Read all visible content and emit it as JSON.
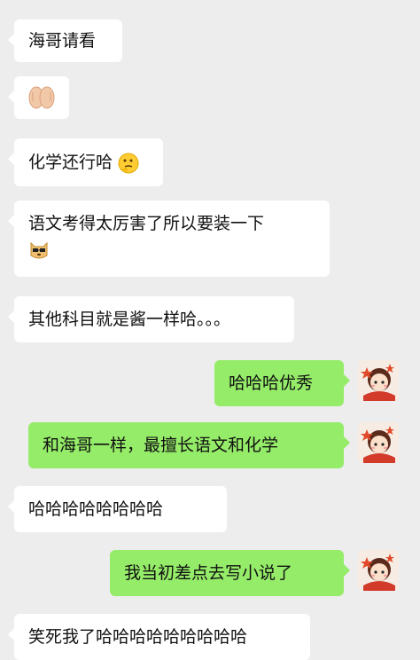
{
  "messages": [
    {
      "side": "left",
      "text": "海哥请看"
    },
    {
      "side": "left",
      "text": "",
      "emoji": "hands-icon"
    },
    {
      "side": "left",
      "text": "化学还行哈",
      "emoji": "thinking-face-icon"
    },
    {
      "side": "left",
      "text": "语文考得太厉害了所以要装一下",
      "emoji": "cool-doge-icon"
    },
    {
      "side": "left",
      "text": "其他科目就是酱一样哈。。。"
    },
    {
      "side": "right",
      "text": "哈哈哈优秀",
      "avatar": "girl-avatar"
    },
    {
      "side": "right",
      "text": "和海哥一样，最擅长语文和化学",
      "avatar": "girl-avatar"
    },
    {
      "side": "left",
      "text": "哈哈哈哈哈哈哈哈"
    },
    {
      "side": "right",
      "text": "我当初差点去写小说了",
      "avatar": "girl-avatar"
    },
    {
      "side": "left",
      "text": "笑死我了哈哈哈哈哈哈哈哈哈"
    }
  ],
  "colors": {
    "background": "#ededed",
    "incoming_bubble": "#ffffff",
    "outgoing_bubble": "#95ec69"
  }
}
